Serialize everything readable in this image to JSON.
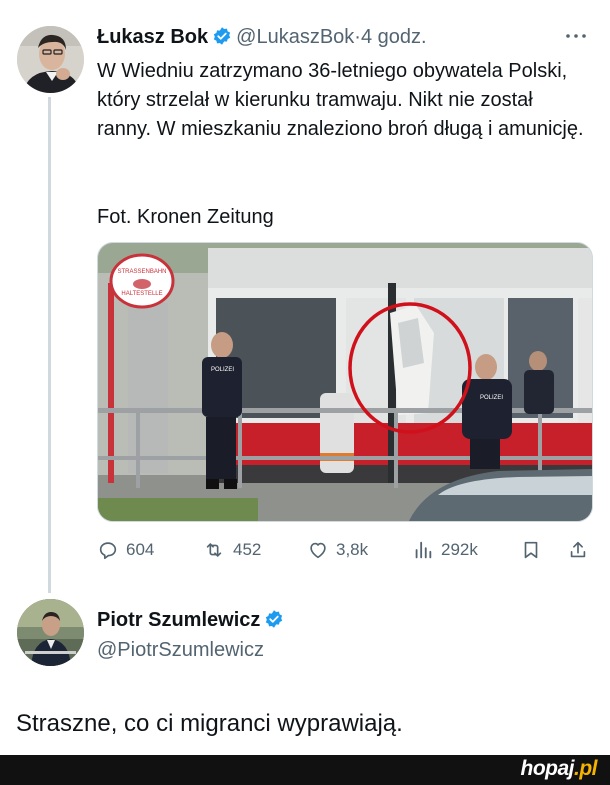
{
  "tweet1": {
    "author_name": "Łukasz Bok",
    "handle": "@LukaszBok",
    "separator": "·",
    "time": "4 godz.",
    "more_icon": "more-horizontal-icon",
    "text": "W Wiedniu zatrzymano 36-letniego obywatela Polski, który strzelał w kierunku tramwaju. Nikt nie został ranny. W mieszkaniu znaleziono broń długą i amunicję.",
    "photo_credit": "Fot. Kronen Zeitung",
    "photo": {
      "sign_text_top": "STRASSENBAHN",
      "sign_text_bottom": "HALTESTELLE",
      "police_label": "POLIZEI",
      "highlight_color": "#d0101a"
    },
    "actions": {
      "replies": "604",
      "retweets": "452",
      "likes": "3,8k",
      "views": "292k"
    }
  },
  "tweet2": {
    "author_name": "Piotr Szumlewicz",
    "handle": "@PiotrSzumlewicz",
    "text": "Straszne, co ci migranci wyprawiają."
  },
  "footer": {
    "watermark_main": "hopaj",
    "watermark_suffix": ".pl"
  },
  "colors": {
    "verified": "#1d9bf0",
    "secondary_text": "#536471",
    "accent": "#f4b400"
  }
}
